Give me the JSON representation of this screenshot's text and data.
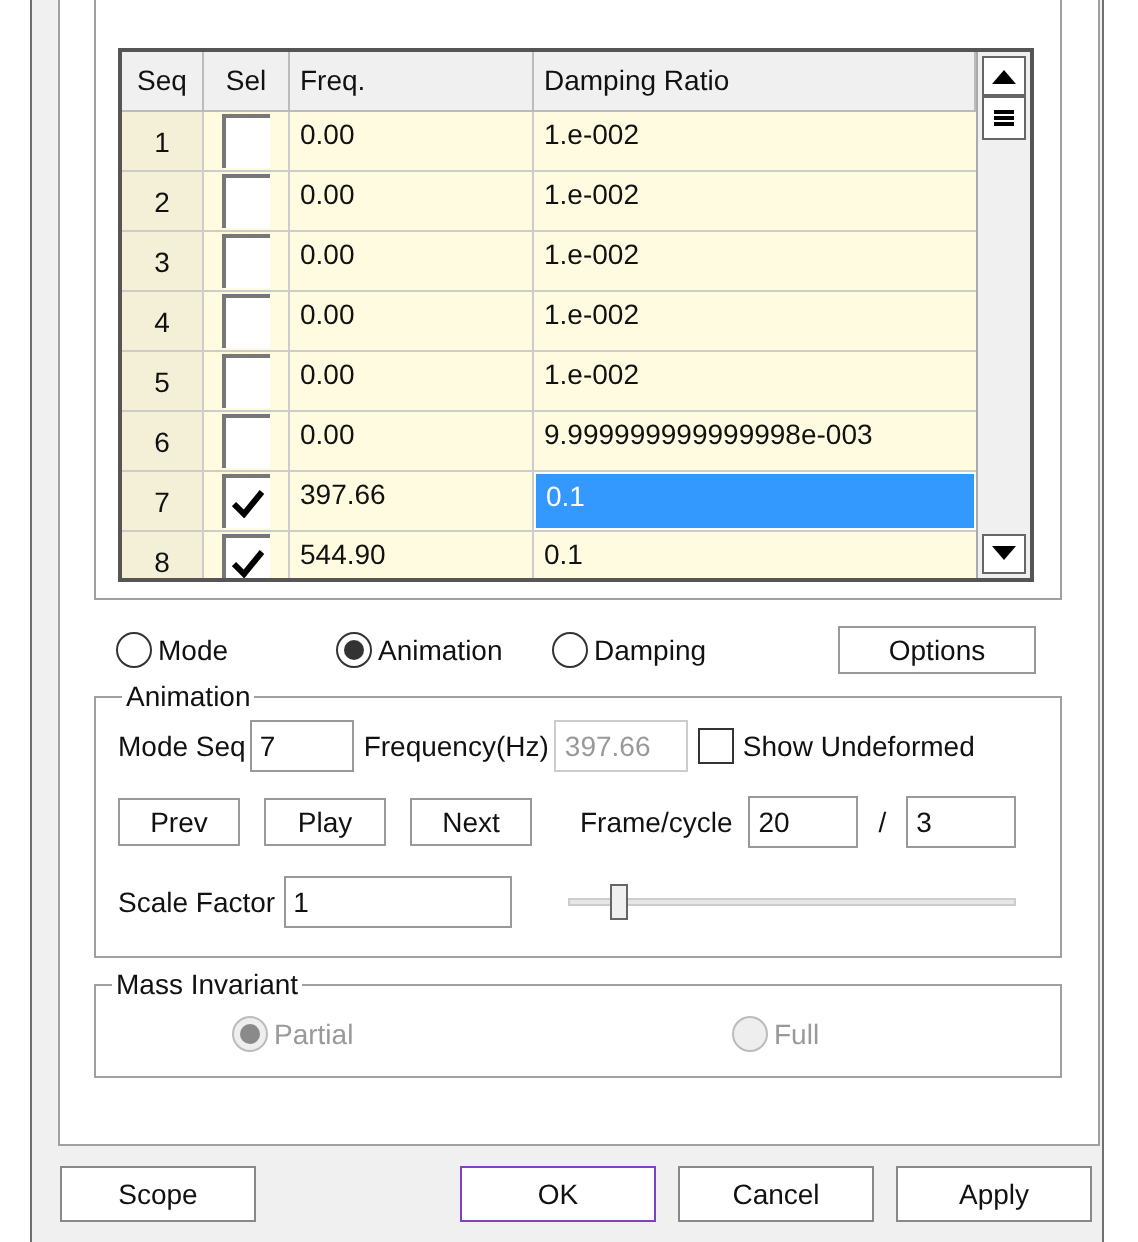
{
  "table": {
    "columns": [
      "Seq",
      "Sel",
      "Freq.",
      "Damping Ratio"
    ],
    "rows": [
      {
        "seq": "1",
        "checked": false,
        "freq": "0.00",
        "damping": "1.e-002",
        "selected": false
      },
      {
        "seq": "2",
        "checked": false,
        "freq": "0.00",
        "damping": "1.e-002",
        "selected": false
      },
      {
        "seq": "3",
        "checked": false,
        "freq": "0.00",
        "damping": "1.e-002",
        "selected": false
      },
      {
        "seq": "4",
        "checked": false,
        "freq": "0.00",
        "damping": "1.e-002",
        "selected": false
      },
      {
        "seq": "5",
        "checked": false,
        "freq": "0.00",
        "damping": "1.e-002",
        "selected": false
      },
      {
        "seq": "6",
        "checked": false,
        "freq": "0.00",
        "damping": "9.999999999999998e-003",
        "selected": false
      },
      {
        "seq": "7",
        "checked": true,
        "freq": "397.66",
        "damping": "0.1",
        "selected": true
      },
      {
        "seq": "8",
        "checked": true,
        "freq": "544.90",
        "damping": "0.1",
        "selected": false
      }
    ]
  },
  "view_modes": [
    {
      "label": "Mode",
      "selected": false
    },
    {
      "label": "Animation",
      "selected": true
    },
    {
      "label": "Damping",
      "selected": false
    }
  ],
  "options_button": "Options",
  "animation": {
    "title": "Animation",
    "mode_seq_label": "Mode Seq",
    "mode_seq": "7",
    "frequency_label": "Frequency(Hz)",
    "frequency": "397.66",
    "show_undeformed": {
      "label": "Show Undeformed",
      "checked": false
    },
    "buttons": [
      "Prev",
      "Play",
      "Next"
    ],
    "frame_cycle_label": "Frame/cycle",
    "frames": "20",
    "separator": "/",
    "cycles": "3",
    "scale_factor_label": "Scale Factor",
    "scale_factor": "1",
    "scale_slider": {
      "level": 0.1
    }
  },
  "mass_invariant": {
    "title": "Mass Invariant",
    "disabled": true,
    "options": [
      {
        "label": "Partial",
        "selected": true
      },
      {
        "label": "Full",
        "selected": false
      }
    ]
  },
  "footer_buttons": [
    {
      "label": "Scope",
      "default": false
    },
    {
      "label": "OK",
      "default": true
    },
    {
      "label": "Cancel",
      "default": false
    },
    {
      "label": "Apply",
      "default": false
    }
  ]
}
